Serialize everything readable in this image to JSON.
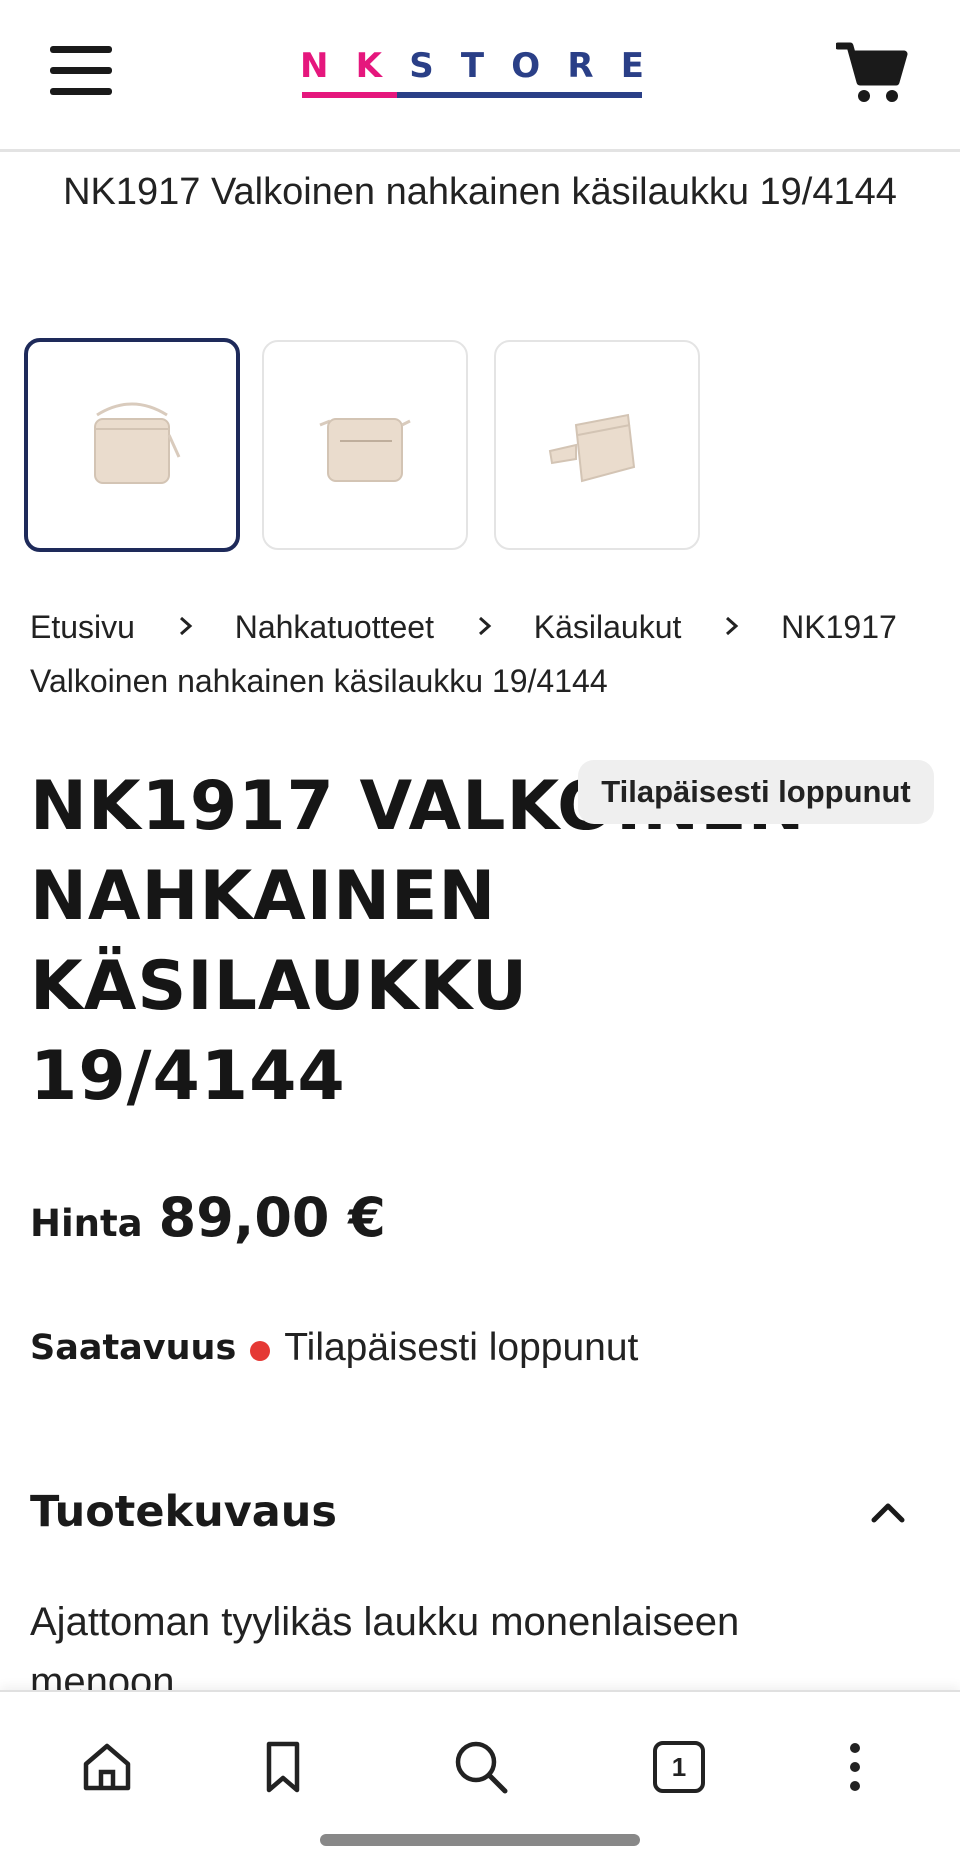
{
  "header": {
    "logo": {
      "part1": [
        "N",
        "K"
      ],
      "part2": [
        "S",
        "T",
        "O",
        "R",
        "E"
      ],
      "colors": {
        "nk": "#e5177d",
        "store": "#2a3f87"
      }
    },
    "menu_icon": "hamburger-menu-icon",
    "cart_icon": "shopping-cart-icon"
  },
  "page_title": "NK1917 Valkoinen nahkainen käsilaukku 19/4144",
  "gallery": {
    "thumbnails": [
      "product-front-view",
      "product-back-view",
      "product-side-view"
    ],
    "active_index": 0,
    "active_border_color": "#1e2a5a"
  },
  "breadcrumb": {
    "items": [
      "Etusivu",
      "Nahkatuotteet",
      "Käsilaukut",
      "NK1917 Valkoinen nahkainen käsilaukku 19/4144"
    ]
  },
  "product": {
    "stock_badge": "Tilapäisesti loppunut",
    "title": "NK1917 VALKOINEN NAHKAINEN KÄSILAUKKU 19/4144",
    "price_label": "Hinta",
    "price": "89,00 €",
    "availability_label": "Saatavuus",
    "availability_value": "Tilapäisesti loppunut",
    "availability_color": "#e53935"
  },
  "description_section": {
    "title": "Tuotekuvaus",
    "expanded": true,
    "text": "Ajattoman tyylikäs laukku monenlaiseen menoon."
  },
  "browser_bar": {
    "tab_count": "1",
    "buttons": [
      "home-icon",
      "bookmark-icon",
      "search-icon",
      "tabs-icon",
      "more-options-icon"
    ]
  }
}
